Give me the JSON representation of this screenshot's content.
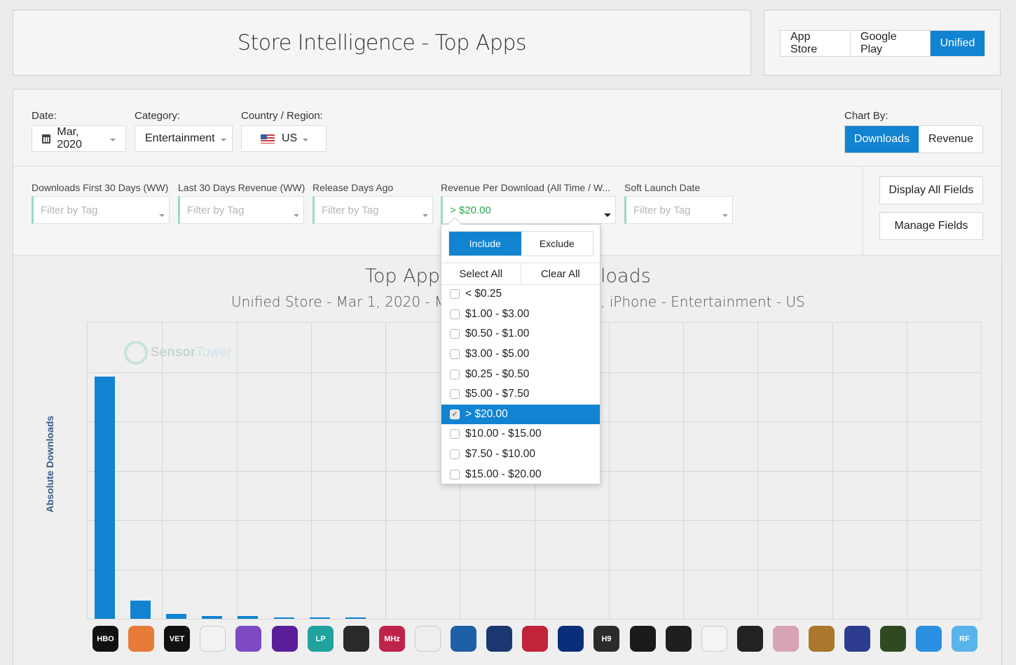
{
  "header": {
    "title": "Store Intelligence - Top Apps"
  },
  "store_toggle": {
    "options": [
      "App Store",
      "Google Play",
      "Unified"
    ],
    "active": "Unified"
  },
  "filters": {
    "date": {
      "label": "Date:",
      "value": "Mar, 2020"
    },
    "category": {
      "label": "Category:",
      "value": "Entertainment"
    },
    "country": {
      "label": "Country / Region:",
      "value": "US"
    },
    "chart_by": {
      "label": "Chart By:",
      "options": [
        "Downloads",
        "Revenue"
      ],
      "active": "Downloads"
    }
  },
  "tag_filters": [
    {
      "label": "Downloads First 30 Days (WW)",
      "value": "",
      "placeholder": "Filter by Tag"
    },
    {
      "label": "Last 30 Days Revenue (WW)",
      "value": "",
      "placeholder": "Filter by Tag"
    },
    {
      "label": "Release Days Ago",
      "value": "",
      "placeholder": "Filter by Tag"
    },
    {
      "label": "Revenue Per Download (All Time / W...",
      "value": "> $20.00",
      "placeholder": ""
    },
    {
      "label": "Soft Launch Date",
      "value": "",
      "placeholder": "Filter by Tag"
    }
  ],
  "field_buttons": {
    "display_all": "Display All Fields",
    "manage": "Manage Fields"
  },
  "dropdown": {
    "include_label": "Include",
    "exclude_label": "Exclude",
    "select_all": "Select All",
    "clear_all": "Clear All",
    "options": [
      {
        "label": "< $0.25",
        "checked": false
      },
      {
        "label": "$1.00 - $3.00",
        "checked": false
      },
      {
        "label": "$0.50 - $1.00",
        "checked": false
      },
      {
        "label": "$3.00 - $5.00",
        "checked": false
      },
      {
        "label": "$0.25 - $0.50",
        "checked": false
      },
      {
        "label": "$5.00 - $7.50",
        "checked": false
      },
      {
        "label": "> $20.00",
        "checked": true
      },
      {
        "label": "$10.00 - $15.00",
        "checked": false
      },
      {
        "label": "$7.50 - $10.00",
        "checked": false
      },
      {
        "label": "$15.00 - $20.00",
        "checked": false
      }
    ]
  },
  "chart": {
    "title_left": "Top Apps",
    "title_right": "loads",
    "subtitle_left": "Unified Store - Mar 1, 2020 - Mar",
    "subtitle_right": ", iPhone - Entertainment - US",
    "y_axis_label": "Absolute Downloads",
    "watermark": {
      "brand_a": "Sensor",
      "brand_b": "Tower"
    }
  },
  "chart_data": {
    "type": "bar",
    "ylabel": "Absolute Downloads",
    "values": [
      1.0,
      0.076,
      0.02,
      0.013,
      0.012,
      0.006,
      0.004,
      0.003,
      0,
      0,
      0,
      0,
      0,
      0,
      0,
      0,
      0,
      0,
      0,
      0,
      0,
      0,
      0,
      0,
      0
    ],
    "value_note": "relative bar heights; y-axis has no tick labels"
  },
  "app_icons": [
    {
      "name": "hbo-now-icon",
      "text": "HBO",
      "color": "#111111"
    },
    {
      "name": "cartoon-icon",
      "text": "",
      "color": "#e87a3a"
    },
    {
      "name": "vet-icon",
      "text": "VET",
      "color": "#111111"
    },
    {
      "name": "barcode-icon",
      "text": "",
      "color": "#f2f2f2"
    },
    {
      "name": "eye-icon",
      "text": "",
      "color": "#7c4bc4"
    },
    {
      "name": "neon-icon",
      "text": "",
      "color": "#5a1e9a"
    },
    {
      "name": "lp-icon",
      "text": "LP",
      "color": "#20a39e"
    },
    {
      "name": "red-swirl-icon",
      "text": "",
      "color": "#2a2a2a"
    },
    {
      "name": "mhz-icon",
      "text": "MHz",
      "color": "#c0234a"
    },
    {
      "name": "network-icon",
      "text": "",
      "color": "#eeeeee"
    },
    {
      "name": "globe-flag-icon",
      "text": "",
      "color": "#1f5fa8"
    },
    {
      "name": "radio-icon",
      "text": "",
      "color": "#1b3770"
    },
    {
      "name": "red-shield-icon",
      "text": "",
      "color": "#c0233a"
    },
    {
      "name": "horse-icon",
      "text": "",
      "color": "#0a2e7a"
    },
    {
      "name": "h9-icon",
      "text": "H9",
      "color": "#2b2b2b"
    },
    {
      "name": "red-c-icon",
      "text": "",
      "color": "#1a1a1a"
    },
    {
      "name": "dial-icon",
      "text": "",
      "color": "#1f1f1f"
    },
    {
      "name": "dots-icon",
      "text": "",
      "color": "#f4f4f4"
    },
    {
      "name": "play-icon",
      "text": "",
      "color": "#222222"
    },
    {
      "name": "portrait-icon",
      "text": "",
      "color": "#d9a3b7"
    },
    {
      "name": "bassoon-icon",
      "text": "",
      "color": "#a9782c"
    },
    {
      "name": "longman-icon",
      "text": "",
      "color": "#2e3c8f"
    },
    {
      "name": "keyboard-icon",
      "text": "",
      "color": "#2f4a22"
    },
    {
      "name": "camera-icon",
      "text": "",
      "color": "#2a8fe0"
    },
    {
      "name": "rf-cockpit-icon",
      "text": "RF",
      "color": "#58b4ea"
    }
  ]
}
